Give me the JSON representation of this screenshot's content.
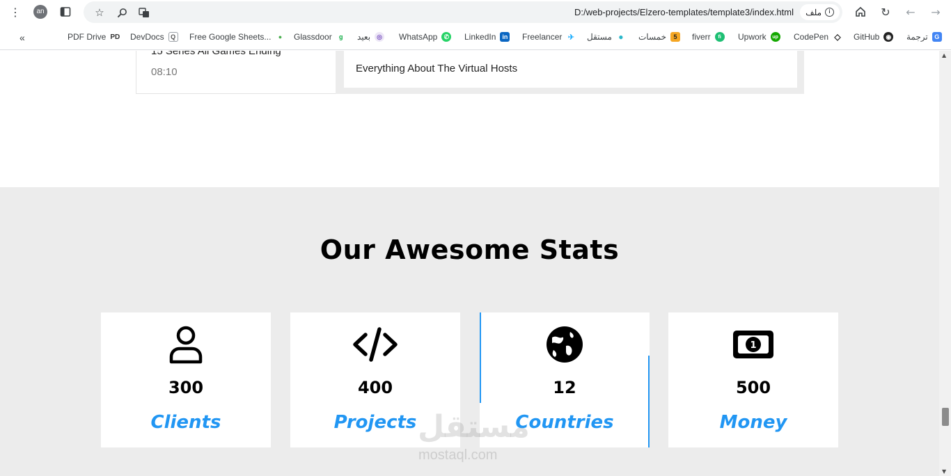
{
  "browser": {
    "avatar_initials": "an",
    "url": "D:/web-projects/Elzero-templates/template3/index.html",
    "chip_label": "ملف"
  },
  "bookmarks": [
    {
      "label": "PDF Drive",
      "icon": "PD",
      "color": "#333333"
    },
    {
      "label": "DevDocs",
      "icon": "Q",
      "color": "#9aa0a6"
    },
    {
      "label": "Free Google Sheets...",
      "icon": "●",
      "color": "#4caf50"
    },
    {
      "label": "Glassdoor",
      "icon": "g",
      "color": "#0caa41"
    },
    {
      "label": "بعيد",
      "icon": "◎",
      "color": "#7e57c2"
    },
    {
      "label": "WhatsApp",
      "icon": "✆",
      "color": "#25d366"
    },
    {
      "label": "LinkedIn",
      "icon": "in",
      "color": "#0a66c2"
    },
    {
      "label": "Freelancer",
      "icon": "✈",
      "color": "#29b2fe"
    },
    {
      "label": "مستقل",
      "icon": "●",
      "color": "#2ab7ca"
    },
    {
      "label": "خمسات",
      "icon": "5",
      "color": "#f5a623"
    },
    {
      "label": "fiverr",
      "icon": "fi",
      "color": "#1dbf73"
    },
    {
      "label": "Upwork",
      "icon": "up",
      "color": "#14a800"
    },
    {
      "label": "CodePen",
      "icon": "◇",
      "color": "#222222"
    },
    {
      "label": "GitHub",
      "icon": "◉",
      "color": "#222222"
    },
    {
      "label": "ترجمة",
      "icon": "G",
      "color": "#4285f4"
    }
  ],
  "articles": {
    "left_title": "15 Series All Games Ending",
    "left_time": "08:10",
    "right_title": "Everything About The Virtual Hosts"
  },
  "stats": {
    "title": "Our Awesome Stats",
    "accent_color": "#2196f3",
    "items": [
      {
        "icon": "user-icon",
        "number": "300",
        "label": "Clients"
      },
      {
        "icon": "code-icon",
        "number": "400",
        "label": "Projects"
      },
      {
        "icon": "globe-icon",
        "number": "12",
        "label": "Countries"
      },
      {
        "icon": "money-icon",
        "number": "500",
        "label": "Money"
      }
    ]
  },
  "watermark": {
    "text": "مستقل",
    "sub": "mostaql.com"
  }
}
